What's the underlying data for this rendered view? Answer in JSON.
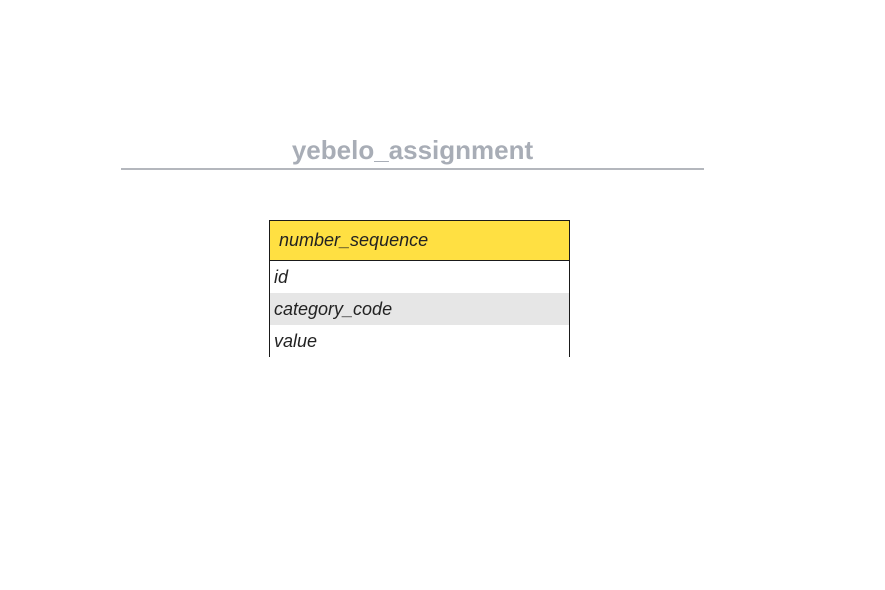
{
  "diagram": {
    "title": "yebelo_assignment",
    "entities": [
      {
        "name": "number_sequence",
        "header_color": "#ffe042",
        "fields": [
          "id",
          "category_code",
          "value"
        ]
      }
    ]
  }
}
